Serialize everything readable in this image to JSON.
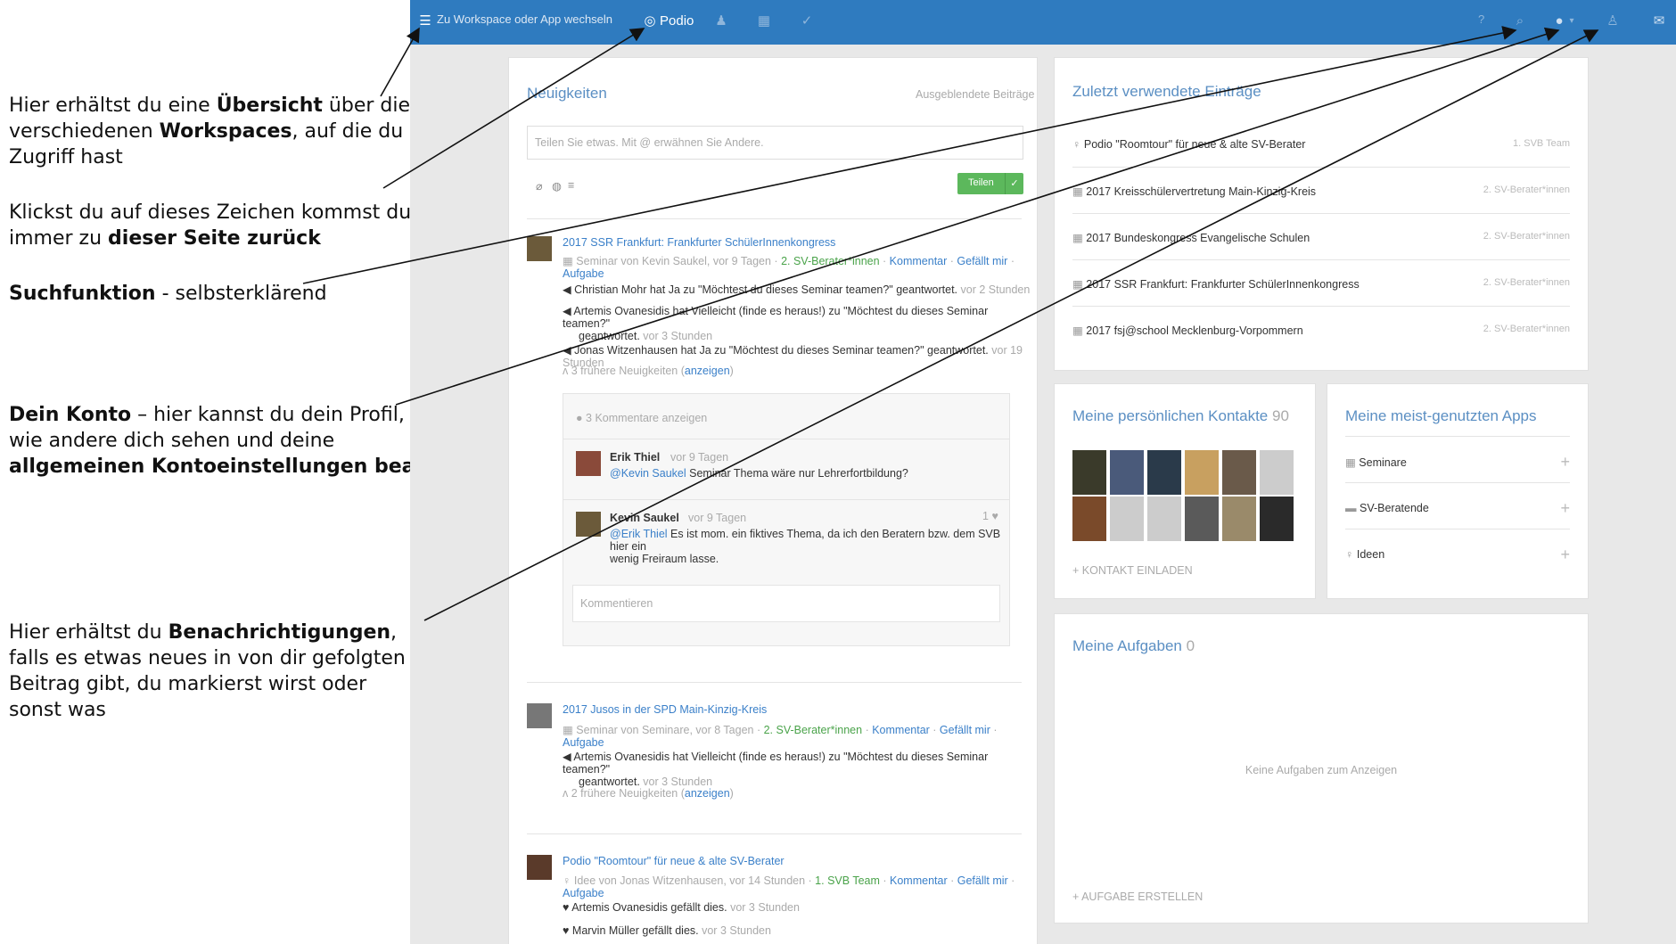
{
  "annotations": {
    "a1": {
      "t1": "Hier erhältst du eine ",
      "b1": "Übersicht",
      "t2": " über die",
      "t3": "verschiedenen ",
      "b2": "Workspaces",
      "t4": ", auf die du",
      "t5": "Zugriff hast"
    },
    "a2": {
      "t1": "Klickst du auf dieses Zeichen kommst du",
      "t2": "immer zu ",
      "b1": "dieser Seite zurück"
    },
    "a3": {
      "b1": "Suchfunktion",
      "t1": " - selbsterklärend"
    },
    "a4": {
      "b1": "Dein Konto",
      "t1": " – hier kannst du dein Profil,",
      "t2": "wie andere dich sehen und deine",
      "b2": "allgemeinen Kontoeinstellungen bearbeiten"
    },
    "a5": {
      "t1": "Hier erhältst du ",
      "b1": "Benachrichtigungen",
      "t2": ",",
      "t3": "falls es etwas neues in von dir gefolgten",
      "t4": "Beitrag gibt, du markierst wirst oder",
      "t5": "sonst was"
    }
  },
  "topbar": {
    "workspace_switch": "Zu Workspace oder App wechseln",
    "brand": "Podio",
    "help": "?"
  },
  "feed": {
    "title": "Neuigkeiten",
    "hidden_link": "Ausgeblendete Beiträge",
    "share_placeholder": "Teilen Sie etwas. Mit @ erwähnen Sie Andere.",
    "share_button": "Teilen",
    "posts": [
      {
        "title": "2017 SSR Frankfurt: Frankfurter SchülerInnenkongress",
        "meta": "Seminar von Kevin Saukel, vor 9 Tagen",
        "space": "2. SV-Berater*innen",
        "actions": [
          "Kommentar",
          "Gefällt mir",
          "Aufgabe"
        ],
        "activities": [
          {
            "text": "Christian Mohr hat Ja zu \"Möchtest du dieses Seminar teamen?\" geantwortet.",
            "time": "vor 2 Stunden"
          },
          {
            "text": "Artemis Ovanesidis hat Vielleicht (finde es heraus!) zu \"Möchtest du dieses Seminar teamen?\"",
            "text2": "geantwortet.",
            "time": "vor 3 Stunden"
          },
          {
            "text": "Jonas Witzenhausen hat Ja zu \"Möchtest du dieses Seminar teamen?\" geantwortet.",
            "time": "vor 19 Stunden"
          }
        ],
        "earlier": "3 frühere Neuigkeiten",
        "earlier_link": "anzeigen",
        "comments_toggle": "3 Kommentare anzeigen",
        "comments": [
          {
            "author": "Erik Thiel",
            "time": "vor 9 Tagen",
            "mention": "@Kevin Saukel",
            "text": " Seminar Thema wäre nur Lehrerfortbildung?"
          },
          {
            "author": "Kevin Saukel",
            "time": "vor 9 Tagen",
            "likes": "1",
            "mention": "@Erik Thiel",
            "text": " Es ist mom. ein fiktives Thema, da ich den Beratern bzw. dem SVB hier ein",
            "text2": "wenig Freiraum lasse."
          }
        ],
        "comment_placeholder": "Kommentieren"
      },
      {
        "title": "2017 Jusos in der SPD Main-Kinzig-Kreis",
        "meta": "Seminar von Seminare, vor 8 Tagen",
        "space": "2. SV-Berater*innen",
        "actions": [
          "Kommentar",
          "Gefällt mir",
          "Aufgabe"
        ],
        "activities": [
          {
            "text": "Artemis Ovanesidis hat Vielleicht (finde es heraus!) zu \"Möchtest du dieses Seminar teamen?\"",
            "text2": "geantwortet.",
            "time": "vor 3 Stunden"
          }
        ],
        "earlier": "2 frühere Neuigkeiten",
        "earlier_link": "anzeigen"
      },
      {
        "title": "Podio \"Roomtour\" für neue & alte SV-Berater",
        "meta": "Idee von Jonas Witzenhausen, vor 14 Stunden",
        "space": "1. SVB Team",
        "actions": [
          "Kommentar",
          "Gefällt mir",
          "Aufgabe"
        ],
        "activities": [
          {
            "text": "Artemis Ovanesidis gefällt dies.",
            "time": "vor 3 Stunden"
          },
          {
            "text": "Marvin Müller gefällt dies.",
            "time": "vor 3 Stunden"
          }
        ]
      }
    ]
  },
  "recent": {
    "title": "Zuletzt verwendete Einträge",
    "items": [
      {
        "icon": "bulb-icon",
        "label": "Podio \"Roomtour\" für neue & alte SV-Berater",
        "space": "1. SVB Team"
      },
      {
        "icon": "calendar-icon",
        "label": "2017 Kreisschülervertretung Main-Kinzig-Kreis",
        "space": "2. SV-Berater*innen"
      },
      {
        "icon": "calendar-icon",
        "label": "2017 Bundeskongress Evangelische Schulen",
        "space": "2. SV-Berater*innen"
      },
      {
        "icon": "calendar-icon",
        "label": "2017 SSR Frankfurt: Frankfurter SchülerInnenkongress",
        "space": "2. SV-Berater*innen"
      },
      {
        "icon": "calendar-icon",
        "label": "2017 fsj@school Mecklenburg-Vorpommern",
        "space": "2. SV-Berater*innen"
      }
    ]
  },
  "contacts": {
    "title": "Meine persönlichen Kontakte",
    "count": "90",
    "invite": "+ KONTAKT EINLADEN"
  },
  "apps": {
    "title": "Meine meist-genutzten Apps",
    "items": [
      {
        "icon": "calendar-icon",
        "label": "Seminare"
      },
      {
        "icon": "stack-icon",
        "label": "SV-Beratende"
      },
      {
        "icon": "bulb-icon",
        "label": "Ideen"
      }
    ]
  },
  "tasks": {
    "title": "Meine Aufgaben",
    "count": "0",
    "empty": "Keine Aufgaben zum Anzeigen",
    "create": "+ AUFGABE ERSTELLEN"
  },
  "colors": {
    "topbar": "#2f7bbf",
    "accent_green": "#5cb85c",
    "link_blue": "#3b80c9"
  }
}
